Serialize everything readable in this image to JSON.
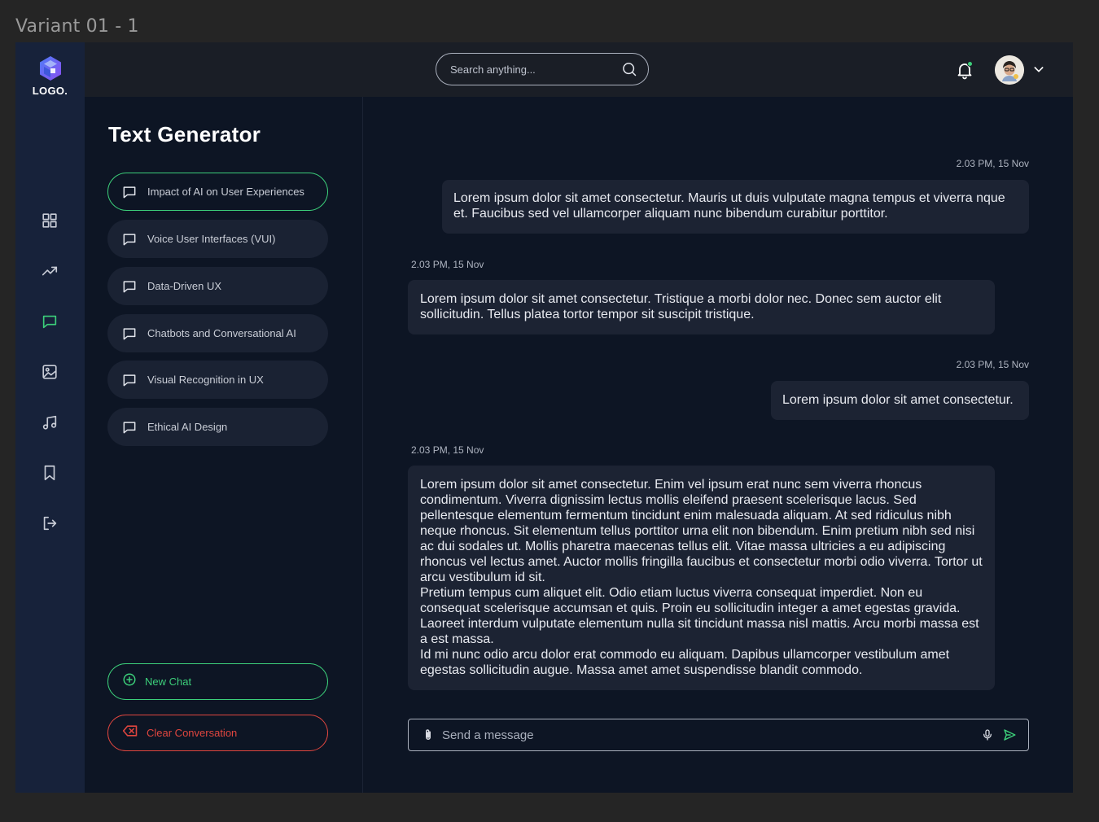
{
  "frame_label": "Variant 01 - 1",
  "brand": {
    "logo_text": "LOGO.",
    "logo_colors": [
      "#4f7cf7",
      "#8a4ff0"
    ]
  },
  "rail": {
    "items": [
      {
        "icon": "grid-icon",
        "active": false
      },
      {
        "icon": "trending-up-icon",
        "active": false
      },
      {
        "icon": "chat-bubble-icon",
        "active": true
      },
      {
        "icon": "image-icon",
        "active": false
      },
      {
        "icon": "music-icon",
        "active": false
      },
      {
        "icon": "bookmark-icon",
        "active": false
      },
      {
        "icon": "logout-icon",
        "active": false
      }
    ]
  },
  "topbar": {
    "search_placeholder": "Search anything...",
    "notification_dot_color": "#3ccf7a"
  },
  "panel": {
    "title": "Text Generator",
    "conversations": [
      {
        "label": "Impact of AI on User Experiences",
        "active": true
      },
      {
        "label": "Voice User Interfaces (VUI)",
        "active": false
      },
      {
        "label": "Data-Driven UX",
        "active": false
      },
      {
        "label": "Chatbots and Conversational AI",
        "active": false
      },
      {
        "label": "Visual Recognition in UX",
        "active": false
      },
      {
        "label": "Ethical AI Design",
        "active": false
      }
    ],
    "new_chat_label": "New Chat",
    "clear_label": "Clear Conversation"
  },
  "chat": {
    "messages": [
      {
        "side": "right",
        "time": "2.03 PM, 15 Nov",
        "paragraphs": [
          "Lorem ipsum dolor sit amet consectetur. Mauris ut duis vulputate magna tempus et viverra nque et. Faucibus sed vel ullamcorper aliquam nunc bibendum curabitur porttitor."
        ]
      },
      {
        "side": "left",
        "time": "2.03 PM, 15 Nov",
        "paragraphs": [
          "Lorem ipsum dolor sit amet consectetur. Tristique a morbi dolor nec. Donec sem auctor elit sollicitudin. Tellus platea tortor tempor sit suscipit tristique."
        ]
      },
      {
        "side": "right",
        "time": "2.03 PM, 15 Nov",
        "paragraphs": [
          "Lorem ipsum dolor sit amet consectetur."
        ]
      },
      {
        "side": "left",
        "time": "2.03 PM, 15 Nov",
        "paragraphs": [
          "Lorem ipsum dolor sit amet consectetur. Enim vel ipsum erat nunc sem viverra rhoncus condimentum. Viverra dignissim lectus mollis eleifend praesent scelerisque lacus. Sed pellentesque elementum fermentum tincidunt enim malesuada aliquam. At sed ridiculus nibh neque rhoncus. Sit elementum tellus porttitor urna elit non bibendum. Enim pretium nibh sed nisi ac dui sodales ut. Mollis pharetra maecenas tellus elit. Vitae massa ultricies a eu adipiscing rhoncus vel lectus amet. Auctor mollis fringilla faucibus et consectetur morbi odio viverra. Tortor ut arcu vestibulum id sit.",
          "Pretium tempus cum aliquet elit. Odio etiam luctus viverra consequat imperdiet. Non eu consequat scelerisque accumsan et quis. Proin eu sollicitudin integer a amet egestas gravida. Laoreet interdum vulputate elementum nulla sit tincidunt massa nisl mattis. Arcu morbi massa est a est massa.",
          "Id mi nunc odio arcu dolor erat commodo eu aliquam. Dapibus ullamcorper vestibulum amet egestas sollicitudin augue. Massa amet amet suspendisse blandit commodo."
        ]
      }
    ],
    "composer_placeholder": "Send a message"
  },
  "colors": {
    "accent_green": "#3ccf7a",
    "danger_red": "#e0463f",
    "background": "#0d1524",
    "rail": "#17223a",
    "bubble": "#1c2333"
  }
}
